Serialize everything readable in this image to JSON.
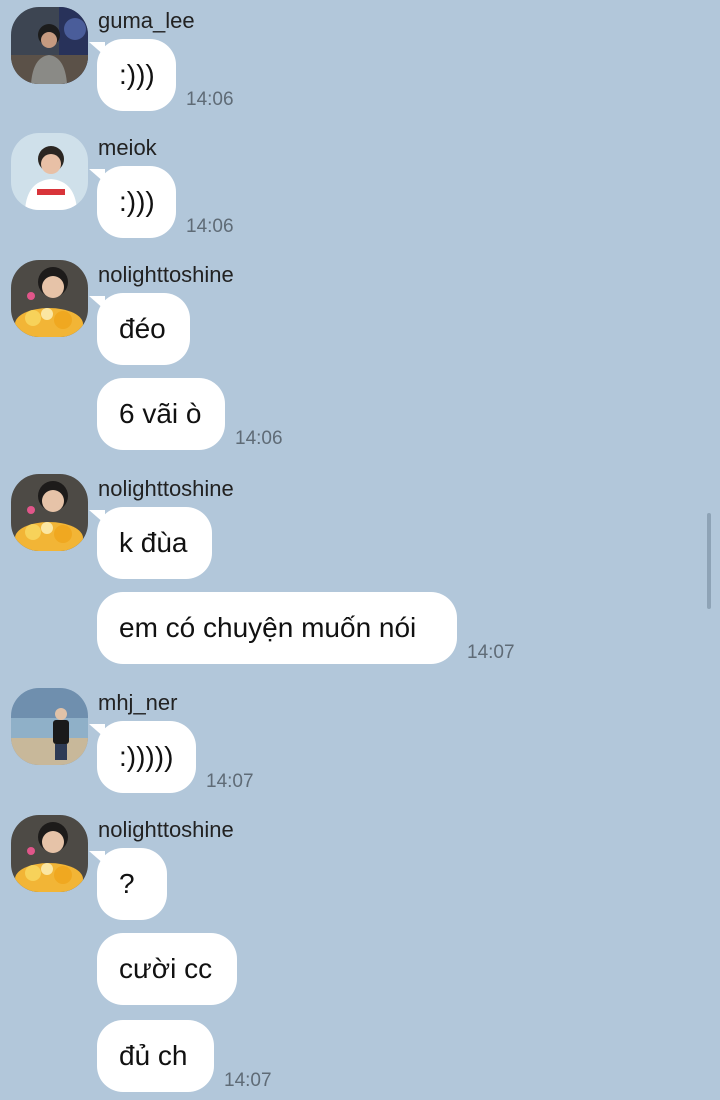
{
  "chat": {
    "groups": [
      {
        "user": "guma_lee",
        "avatar_icon": "user-photo-guma-lee",
        "messages": [
          ":)))"
        ],
        "time": "14:06"
      },
      {
        "user": "meiok",
        "avatar_icon": "user-photo-meiok",
        "messages": [
          ":)))"
        ],
        "time": "14:06"
      },
      {
        "user": "nolighttoshine",
        "avatar_icon": "user-photo-nolighttoshine",
        "messages": [
          "đéo",
          "6 vãi ò"
        ],
        "time": "14:06"
      },
      {
        "user": "nolighttoshine",
        "avatar_icon": "user-photo-nolighttoshine",
        "messages": [
          "k đùa",
          "em có chuyện muốn nói"
        ],
        "time": "14:07"
      },
      {
        "user": "mhj_ner",
        "avatar_icon": "user-photo-mhj-ner",
        "messages": [
          ":)))))"
        ],
        "time": "14:07"
      },
      {
        "user": "nolighttoshine",
        "avatar_icon": "user-photo-nolighttoshine",
        "messages": [
          "?",
          "cười cc",
          "đủ ch"
        ],
        "time": "14:07"
      }
    ]
  },
  "colors": {
    "background": "#b2c7da",
    "bubble": "#ffffff",
    "timestamp": "#5f6b76"
  }
}
